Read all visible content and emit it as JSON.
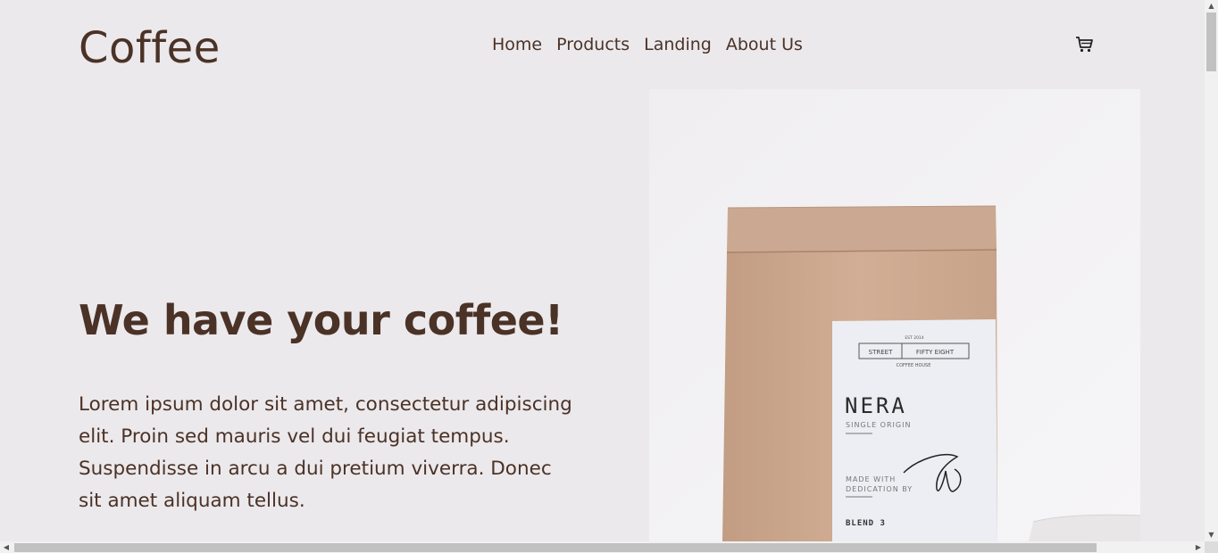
{
  "header": {
    "logo": "Coffee",
    "nav": [
      {
        "label": "Home"
      },
      {
        "label": "Products"
      },
      {
        "label": "Landing"
      },
      {
        "label": "About Us"
      }
    ],
    "cart_icon": "shopping-cart-icon"
  },
  "hero": {
    "title": "We have your coffee!",
    "body": "Lorem ipsum dolor sit amet, consectetur adipiscing elit. Proin sed mauris vel dui feugiat tempus. Suspendisse in arcu a dui pretium viverra. Donec sit amet aliquam tellus.",
    "image": {
      "label_top": "EST 2014",
      "label_left": "STREET",
      "label_right": "FIFTY EIGHT",
      "label_house": "COFFEE HOUSE",
      "brand": "NERA",
      "origin": "SINGLE ORIGIN",
      "made_with": "MADE WITH",
      "dedication": "DEDICATION BY",
      "blend": "BLEND 3"
    }
  },
  "colors": {
    "background": "#ece9ec",
    "text": "#4a3226",
    "bag": "#c9a58a",
    "label": "#eef0f4"
  }
}
